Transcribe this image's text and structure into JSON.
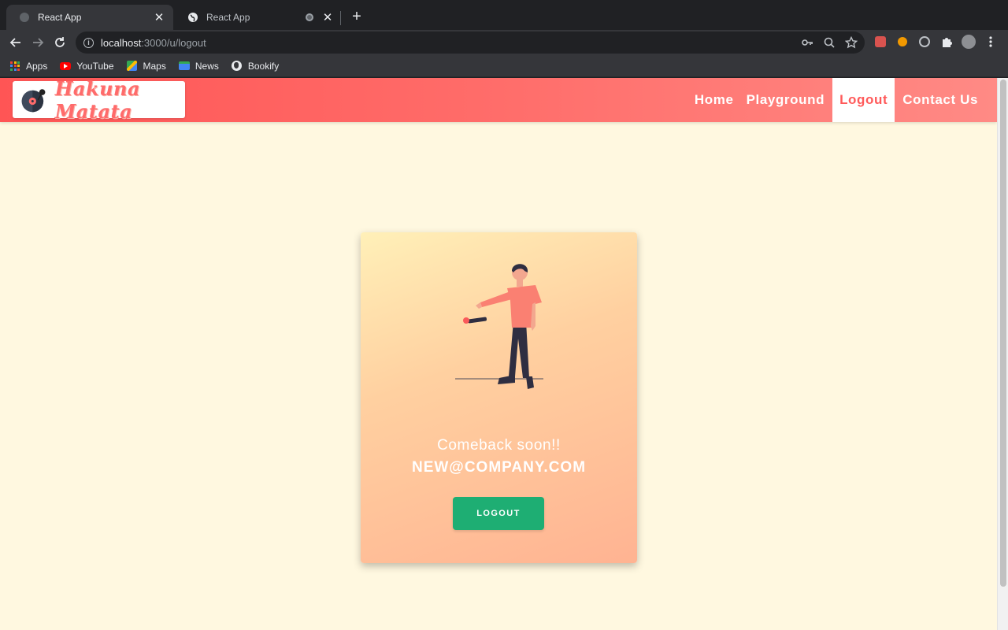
{
  "browser": {
    "tabs": [
      {
        "title": "React App",
        "active": true
      },
      {
        "title": "React App",
        "active": false
      }
    ],
    "close_glyph": "✕",
    "new_tab_glyph": "+",
    "url_host": "localhost",
    "url_path": ":3000/u/logout",
    "bookmarks": [
      "Apps",
      "YouTube",
      "Maps",
      "News",
      "Bookify"
    ],
    "icons": {
      "back": "back-arrow-icon",
      "forward": "forward-arrow-icon",
      "reload": "reload-icon",
      "key": "key-icon",
      "zoom": "zoom-icon",
      "star": "bookmark-star-icon",
      "extensions": "puzzle-icon",
      "menu": "kebab-menu-icon"
    }
  },
  "app": {
    "logo_text": "Hakuna Matata",
    "nav": [
      {
        "label": "Home",
        "active": false
      },
      {
        "label": "Playground",
        "active": false
      },
      {
        "label": "Logout",
        "active": true
      },
      {
        "label": "Contact Us",
        "active": false
      }
    ],
    "card": {
      "message": "Comeback soon!!",
      "email": "NEW@COMPANY.COM",
      "button_label": "LOGOUT"
    },
    "colors": {
      "header_start": "#ff5555",
      "header_end": "#ff8a85",
      "page_bg": "#fff8e0",
      "button_bg": "#1eae73",
      "accent": "#ff5a5a"
    }
  }
}
